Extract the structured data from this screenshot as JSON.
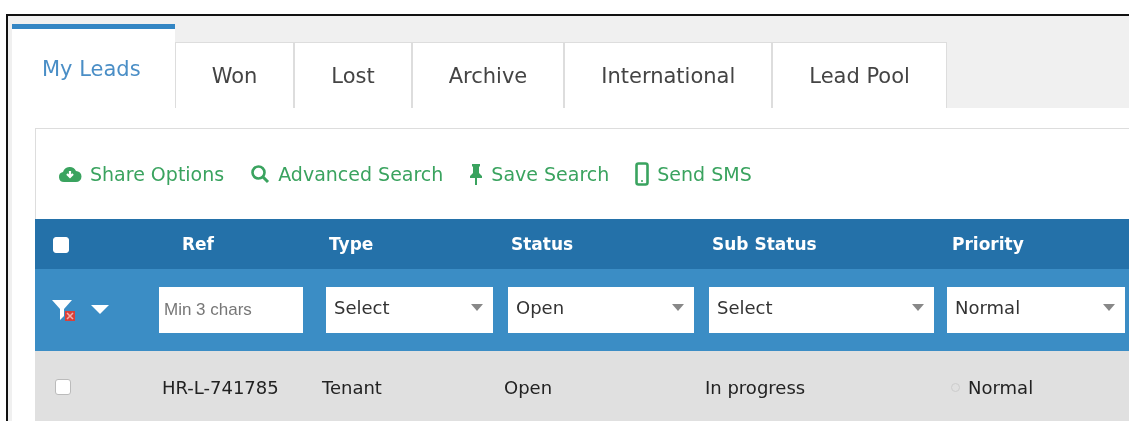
{
  "tabs": [
    {
      "label": "My Leads",
      "selected": true
    },
    {
      "label": "Won",
      "selected": false
    },
    {
      "label": "Lost",
      "selected": false
    },
    {
      "label": "Archive",
      "selected": false
    },
    {
      "label": "International",
      "selected": false
    },
    {
      "label": "Lead Pool",
      "selected": false
    }
  ],
  "toolbar": [
    {
      "kind": "share",
      "label": "Share Options"
    },
    {
      "kind": "search",
      "label": "Advanced Search"
    },
    {
      "kind": "save",
      "label": "Save Search"
    },
    {
      "kind": "sms",
      "label": "Send SMS"
    }
  ],
  "table": {
    "select_all": {
      "checked": false
    },
    "columns": [
      "Ref",
      "Type",
      "Status",
      "Sub Status",
      "Priority"
    ],
    "filters": [
      {
        "kind": "text",
        "placeholder": "Min 3 chars"
      },
      {
        "kind": "select",
        "value": "Select"
      },
      {
        "kind": "select",
        "value": "Open"
      },
      {
        "kind": "select",
        "value": "Select"
      },
      {
        "kind": "select",
        "value": "Normal"
      }
    ],
    "rows": [
      {
        "checked": false,
        "cells": [
          "HR-L-741785",
          "Tenant",
          "Open",
          "In progress",
          "Normal"
        ]
      }
    ]
  }
}
